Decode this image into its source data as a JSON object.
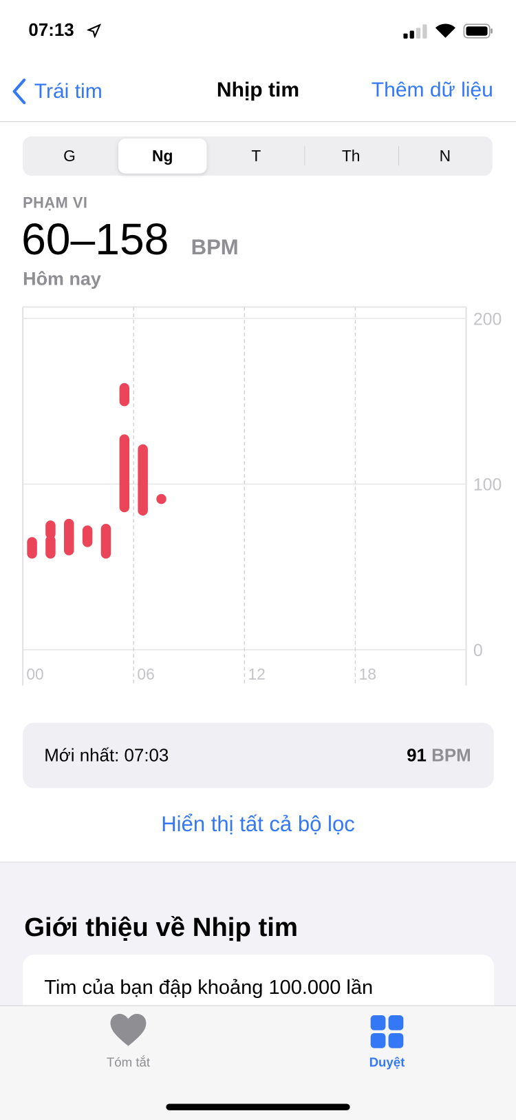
{
  "status_bar": {
    "time": "07:13",
    "icons": [
      "location-arrow-icon",
      "signal-icon",
      "wifi-icon",
      "battery-icon"
    ]
  },
  "nav": {
    "back_label": "Trái tim",
    "title": "Nhịp tim",
    "action_label": "Thêm dữ liệu"
  },
  "segments": {
    "items": [
      "G",
      "Ng",
      "T",
      "Th",
      "N"
    ],
    "selected": "Ng"
  },
  "summary": {
    "label": "PHẠM VI",
    "value": "60–158",
    "unit": "BPM",
    "period": "Hôm nay"
  },
  "chart_data": {
    "type": "range-bar",
    "x_ticks": [
      "00",
      "06",
      "12",
      "18"
    ],
    "y_ticks": [
      "0",
      "100",
      "200"
    ],
    "ylim": [
      0,
      200
    ],
    "xlim_hours": [
      0,
      24
    ],
    "color": "#ea4559",
    "ranges": [
      {
        "hour": 0,
        "min": 58,
        "max": 65
      },
      {
        "hour": 1,
        "min": 58,
        "max": 66
      },
      {
        "hour": 1,
        "min": 70,
        "max": 75
      },
      {
        "hour": 2,
        "min": 60,
        "max": 76
      },
      {
        "hour": 3,
        "min": 65,
        "max": 72
      },
      {
        "hour": 4,
        "min": 58,
        "max": 73
      },
      {
        "hour": 5,
        "min": 150,
        "max": 158
      },
      {
        "hour": 5,
        "min": 86,
        "max": 127
      },
      {
        "hour": 6,
        "min": 84,
        "max": 121
      },
      {
        "hour": 7,
        "min": 91,
        "max": 91
      }
    ]
  },
  "latest": {
    "label": "Mới nhất: 07:03",
    "value": "91",
    "unit": "BPM"
  },
  "show_filters": "Hiển thị tất cả bộ lọc",
  "about": {
    "title": "Giới thiệu về Nhịp tim",
    "text": "Tim của bạn đập khoảng 100.000 lần"
  },
  "tabbar": {
    "items": [
      {
        "label": "Tóm tắt",
        "icon": "heart-icon",
        "active": false
      },
      {
        "label": "Duyệt",
        "icon": "grid-icon",
        "active": true
      }
    ],
    "active_color": "#3478f6"
  }
}
